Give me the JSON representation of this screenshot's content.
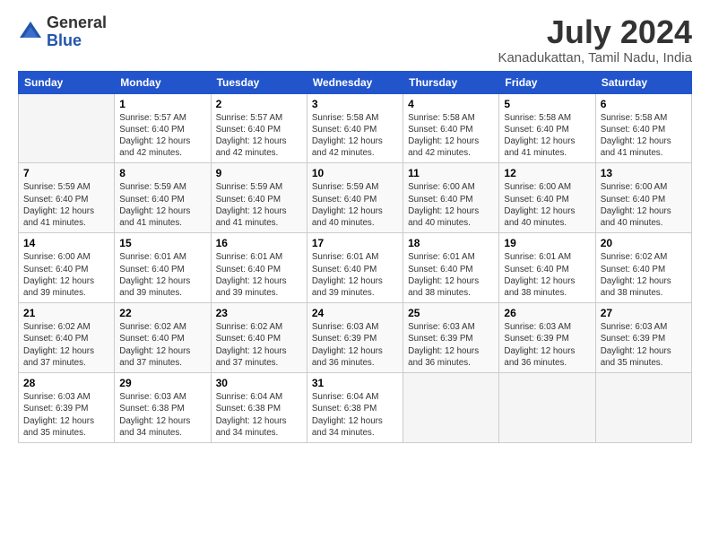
{
  "logo": {
    "general": "General",
    "blue": "Blue"
  },
  "title": "July 2024",
  "subtitle": "Kanadukattan, Tamil Nadu, India",
  "days_of_week": [
    "Sunday",
    "Monday",
    "Tuesday",
    "Wednesday",
    "Thursday",
    "Friday",
    "Saturday"
  ],
  "weeks": [
    [
      {
        "day": "",
        "info": ""
      },
      {
        "day": "1",
        "info": "Sunrise: 5:57 AM\nSunset: 6:40 PM\nDaylight: 12 hours\nand 42 minutes."
      },
      {
        "day": "2",
        "info": "Sunrise: 5:57 AM\nSunset: 6:40 PM\nDaylight: 12 hours\nand 42 minutes."
      },
      {
        "day": "3",
        "info": "Sunrise: 5:58 AM\nSunset: 6:40 PM\nDaylight: 12 hours\nand 42 minutes."
      },
      {
        "day": "4",
        "info": "Sunrise: 5:58 AM\nSunset: 6:40 PM\nDaylight: 12 hours\nand 42 minutes."
      },
      {
        "day": "5",
        "info": "Sunrise: 5:58 AM\nSunset: 6:40 PM\nDaylight: 12 hours\nand 41 minutes."
      },
      {
        "day": "6",
        "info": "Sunrise: 5:58 AM\nSunset: 6:40 PM\nDaylight: 12 hours\nand 41 minutes."
      }
    ],
    [
      {
        "day": "7",
        "info": "Sunrise: 5:59 AM\nSunset: 6:40 PM\nDaylight: 12 hours\nand 41 minutes."
      },
      {
        "day": "8",
        "info": "Sunrise: 5:59 AM\nSunset: 6:40 PM\nDaylight: 12 hours\nand 41 minutes."
      },
      {
        "day": "9",
        "info": "Sunrise: 5:59 AM\nSunset: 6:40 PM\nDaylight: 12 hours\nand 41 minutes."
      },
      {
        "day": "10",
        "info": "Sunrise: 5:59 AM\nSunset: 6:40 PM\nDaylight: 12 hours\nand 40 minutes."
      },
      {
        "day": "11",
        "info": "Sunrise: 6:00 AM\nSunset: 6:40 PM\nDaylight: 12 hours\nand 40 minutes."
      },
      {
        "day": "12",
        "info": "Sunrise: 6:00 AM\nSunset: 6:40 PM\nDaylight: 12 hours\nand 40 minutes."
      },
      {
        "day": "13",
        "info": "Sunrise: 6:00 AM\nSunset: 6:40 PM\nDaylight: 12 hours\nand 40 minutes."
      }
    ],
    [
      {
        "day": "14",
        "info": "Sunrise: 6:00 AM\nSunset: 6:40 PM\nDaylight: 12 hours\nand 39 minutes."
      },
      {
        "day": "15",
        "info": "Sunrise: 6:01 AM\nSunset: 6:40 PM\nDaylight: 12 hours\nand 39 minutes."
      },
      {
        "day": "16",
        "info": "Sunrise: 6:01 AM\nSunset: 6:40 PM\nDaylight: 12 hours\nand 39 minutes."
      },
      {
        "day": "17",
        "info": "Sunrise: 6:01 AM\nSunset: 6:40 PM\nDaylight: 12 hours\nand 39 minutes."
      },
      {
        "day": "18",
        "info": "Sunrise: 6:01 AM\nSunset: 6:40 PM\nDaylight: 12 hours\nand 38 minutes."
      },
      {
        "day": "19",
        "info": "Sunrise: 6:01 AM\nSunset: 6:40 PM\nDaylight: 12 hours\nand 38 minutes."
      },
      {
        "day": "20",
        "info": "Sunrise: 6:02 AM\nSunset: 6:40 PM\nDaylight: 12 hours\nand 38 minutes."
      }
    ],
    [
      {
        "day": "21",
        "info": "Sunrise: 6:02 AM\nSunset: 6:40 PM\nDaylight: 12 hours\nand 37 minutes."
      },
      {
        "day": "22",
        "info": "Sunrise: 6:02 AM\nSunset: 6:40 PM\nDaylight: 12 hours\nand 37 minutes."
      },
      {
        "day": "23",
        "info": "Sunrise: 6:02 AM\nSunset: 6:40 PM\nDaylight: 12 hours\nand 37 minutes."
      },
      {
        "day": "24",
        "info": "Sunrise: 6:03 AM\nSunset: 6:39 PM\nDaylight: 12 hours\nand 36 minutes."
      },
      {
        "day": "25",
        "info": "Sunrise: 6:03 AM\nSunset: 6:39 PM\nDaylight: 12 hours\nand 36 minutes."
      },
      {
        "day": "26",
        "info": "Sunrise: 6:03 AM\nSunset: 6:39 PM\nDaylight: 12 hours\nand 36 minutes."
      },
      {
        "day": "27",
        "info": "Sunrise: 6:03 AM\nSunset: 6:39 PM\nDaylight: 12 hours\nand 35 minutes."
      }
    ],
    [
      {
        "day": "28",
        "info": "Sunrise: 6:03 AM\nSunset: 6:39 PM\nDaylight: 12 hours\nand 35 minutes."
      },
      {
        "day": "29",
        "info": "Sunrise: 6:03 AM\nSunset: 6:38 PM\nDaylight: 12 hours\nand 34 minutes."
      },
      {
        "day": "30",
        "info": "Sunrise: 6:04 AM\nSunset: 6:38 PM\nDaylight: 12 hours\nand 34 minutes."
      },
      {
        "day": "31",
        "info": "Sunrise: 6:04 AM\nSunset: 6:38 PM\nDaylight: 12 hours\nand 34 minutes."
      },
      {
        "day": "",
        "info": ""
      },
      {
        "day": "",
        "info": ""
      },
      {
        "day": "",
        "info": ""
      }
    ]
  ]
}
